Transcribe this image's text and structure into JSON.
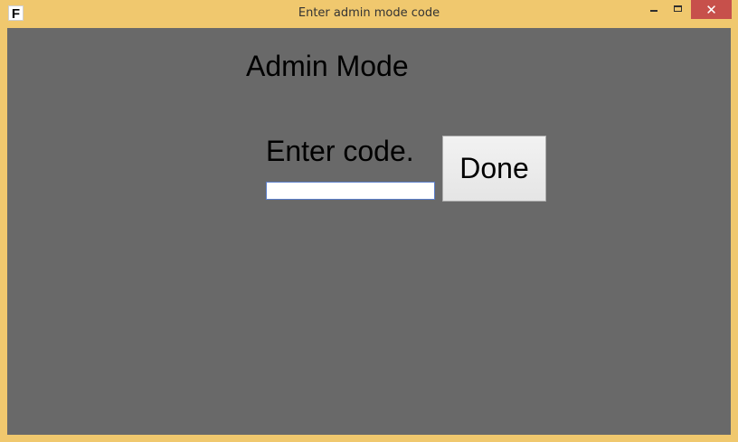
{
  "window": {
    "title": "Enter admin mode code",
    "icon": "F",
    "close_glyph": "✕",
    "controls": [
      "minimize-icon",
      "maximize-icon",
      "close-icon"
    ],
    "colors": {
      "frame": "#f0c86e",
      "client_bg": "#696969",
      "close_bg": "#c7504b"
    }
  },
  "main": {
    "heading": "Admin Mode",
    "prompt": "Enter code.",
    "code_input": {
      "value": "",
      "placeholder": ""
    },
    "done_label": "Done"
  }
}
